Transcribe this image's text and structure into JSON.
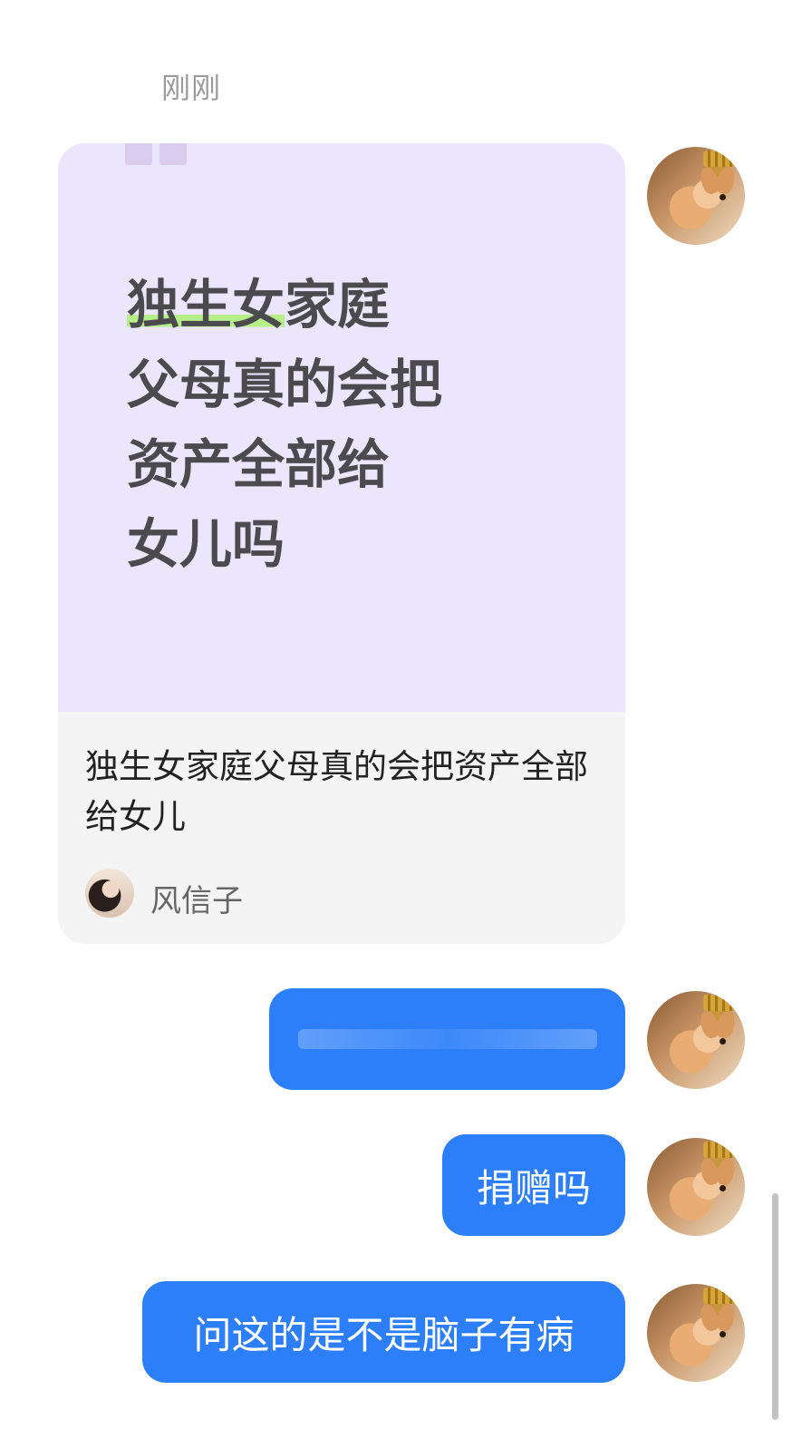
{
  "chat": {
    "timestamp": "刚刚",
    "shared_card": {
      "cover_lines": [
        {
          "highlight": "独生女",
          "rest": "家庭"
        },
        {
          "highlight": "",
          "rest": "父母真的会把"
        },
        {
          "highlight": "",
          "rest": "资产全部给"
        },
        {
          "highlight": "",
          "rest": "女儿吗"
        }
      ],
      "title": "独生女家庭父母真的会把资产全部给女儿",
      "author": "风信子"
    },
    "messages": [
      {
        "text": "",
        "redacted": true
      },
      {
        "text": "捐赠吗"
      },
      {
        "text": "问这的是不是脑子有病"
      }
    ]
  },
  "colors": {
    "bubble": "#2d7ff9",
    "card_cover": "#ebe6fb",
    "highlight": "#b6ef8a"
  }
}
